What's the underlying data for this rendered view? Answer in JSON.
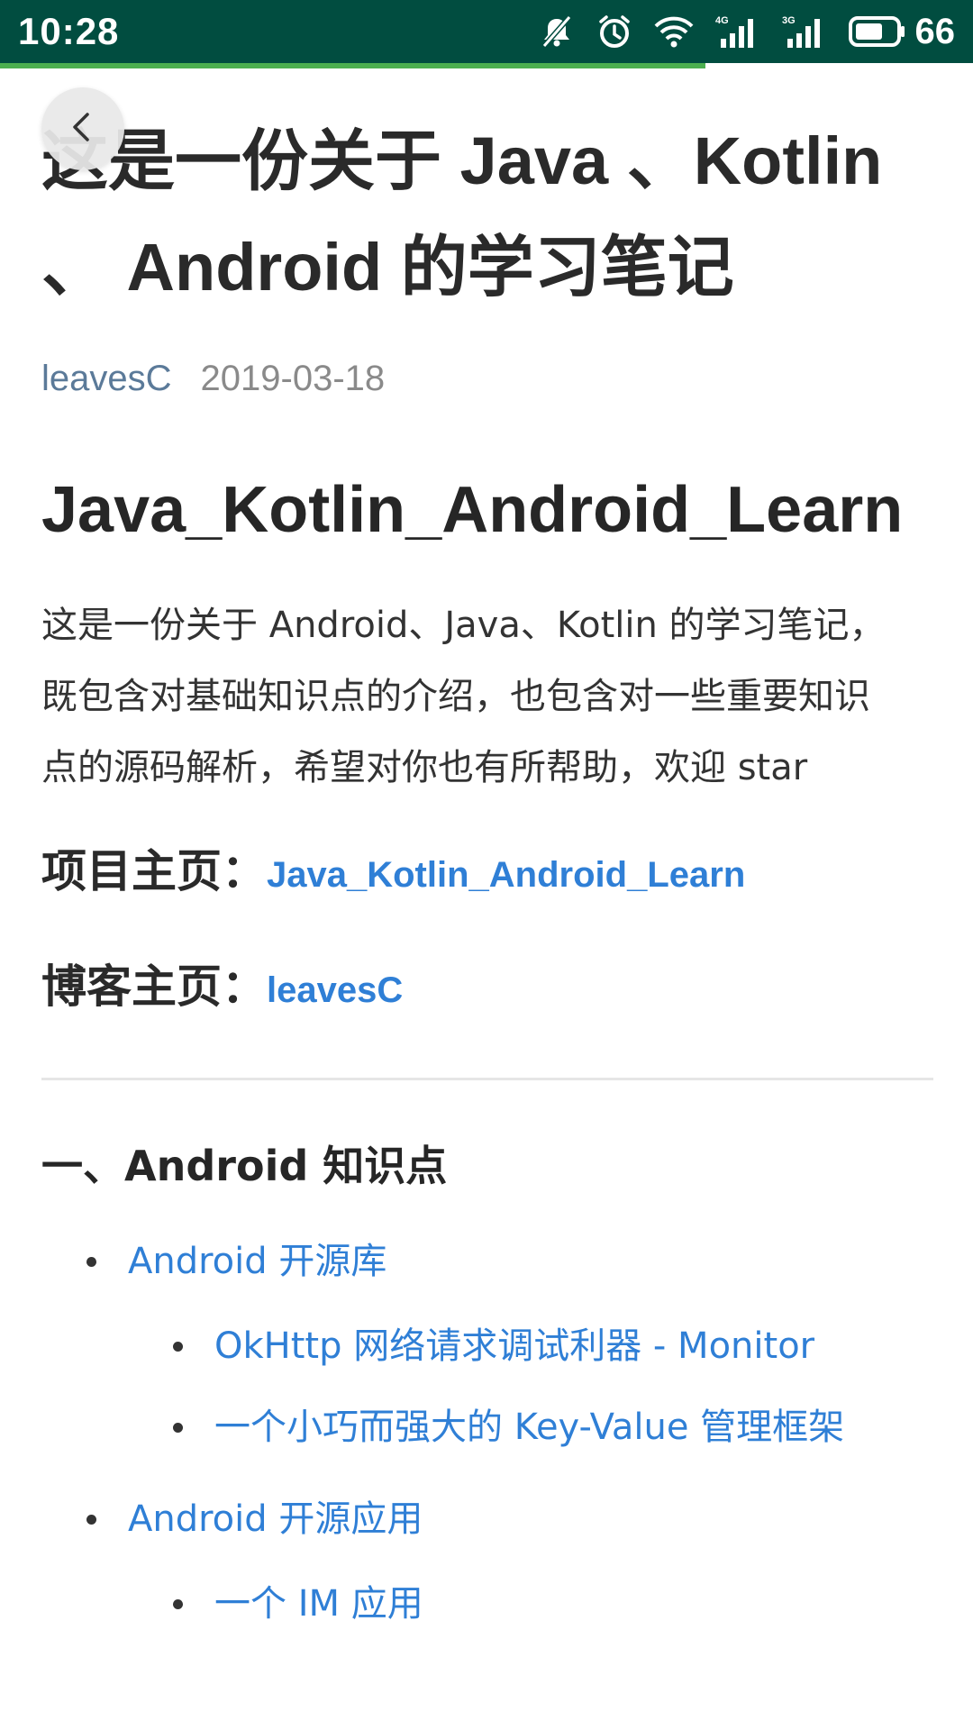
{
  "status_bar": {
    "time": "10:28",
    "battery": "66",
    "icons": [
      "mute-bell-icon",
      "alarm-icon",
      "wifi-icon",
      "signal-4g-icon",
      "signal-3g-icon",
      "battery-icon"
    ],
    "net_4g": "4G",
    "net_3g": "3G"
  },
  "page_load_progress": 0.725,
  "colors": {
    "status_bar_bg": "#014d40",
    "progress": "#4caf50",
    "link": "#2f7fd6",
    "author": "#5b7a99"
  },
  "article": {
    "title_line1": "这是一份关于 Java 、Kotlin",
    "title_line2": "、 Android 的学习笔记",
    "author": "leavesC",
    "date": "2019-03-18",
    "heading": "Java_Kotlin_Android_Learn",
    "intro_line1": "这是一份关于 Android、Java、Kotlin 的学习笔记，",
    "intro_line2": "既包含对基础知识点的介绍，也包含对一些重要知识",
    "intro_line3": "点的源码解析，希望对你也有所帮助，欢迎 star",
    "project_label": "项目主页：",
    "project_link": "Java_Kotlin_Android_Learn",
    "blog_label": "博客主页：",
    "blog_link": "leavesC",
    "section_heading": "一、Android 知识点",
    "items": [
      {
        "label": "Android 开源库",
        "children": [
          "OkHttp 网络请求调试利器 - Monitor",
          "一个小巧而强大的 Key-Value 管理框架"
        ]
      },
      {
        "label": "Android 开源应用",
        "children": [
          "一个 IM 应用"
        ]
      }
    ]
  }
}
